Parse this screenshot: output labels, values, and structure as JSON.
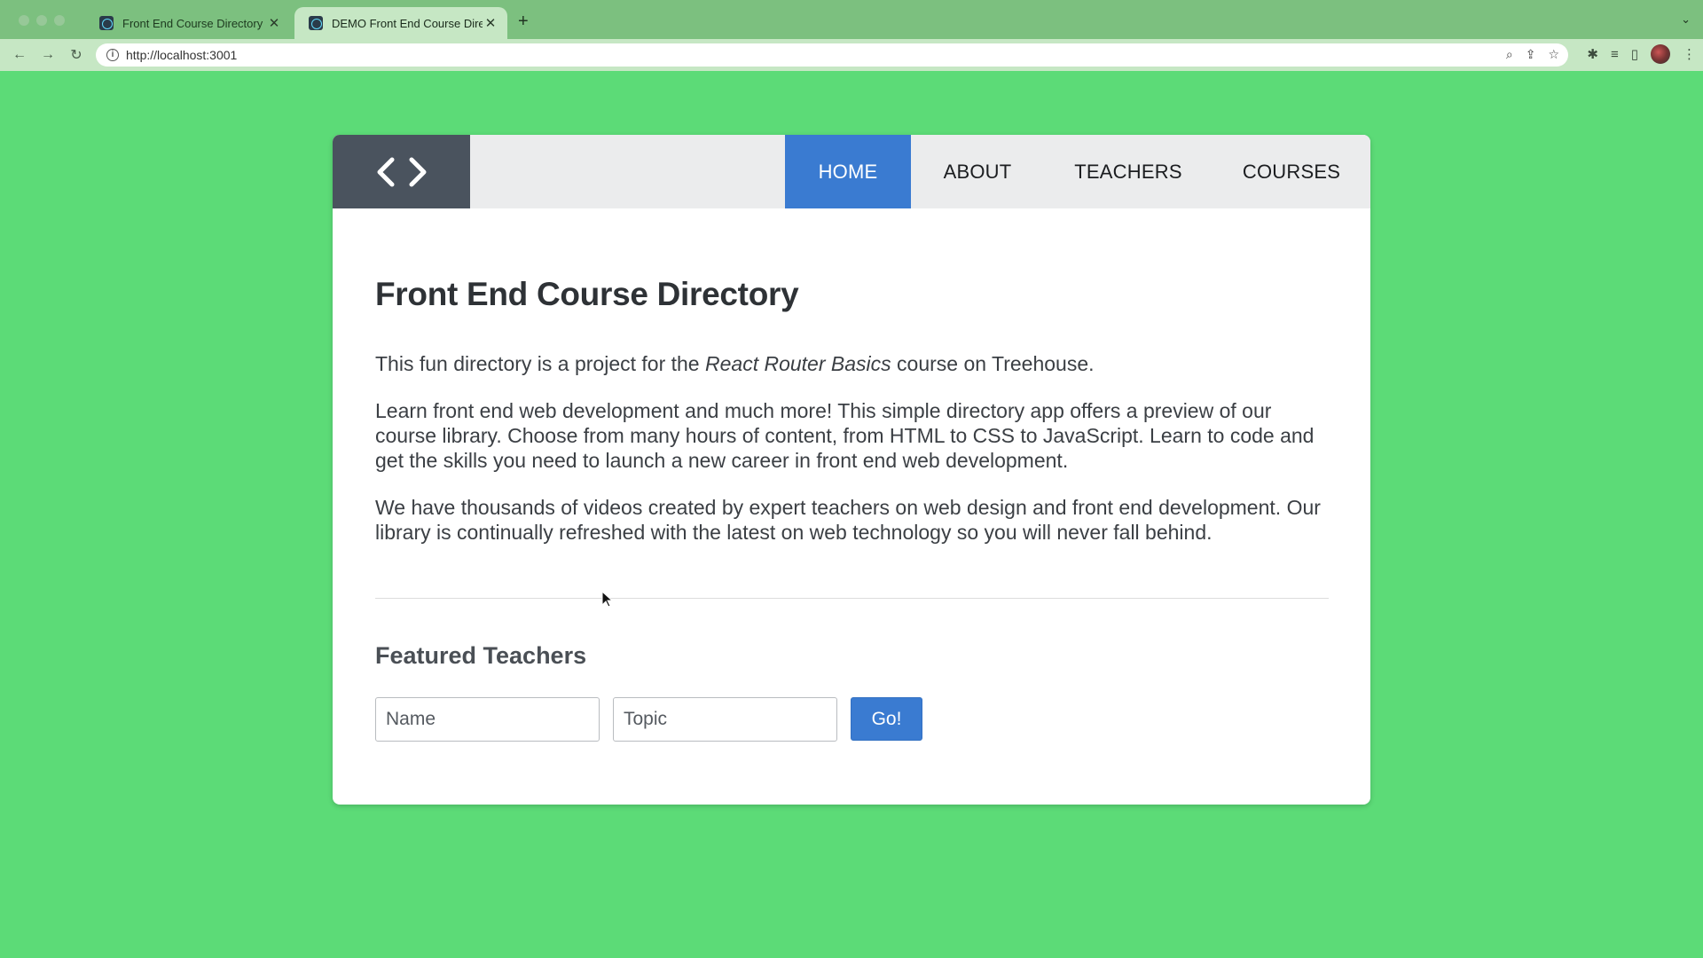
{
  "browser": {
    "tabs": [
      {
        "title": "Front End Course Directory",
        "active": false
      },
      {
        "title": "DEMO Front End Course Direct",
        "active": true
      }
    ],
    "new_tab_label": "+",
    "url": "http://localhost:3001"
  },
  "site": {
    "logo_icon": "code-brackets-icon",
    "nav": {
      "home": "HOME",
      "about": "ABOUT",
      "teachers": "TEACHERS",
      "courses": "COURSES"
    },
    "active_nav": "home",
    "accent_color": "#3a7bd1"
  },
  "page": {
    "title": "Front End Course Directory",
    "intro_before": "This fun directory is a project for the ",
    "intro_emphasis": "React Router Basics",
    "intro_after": " course on Treehouse.",
    "paragraph_2": "Learn front end web development and much more! This simple directory app offers a preview of our course library. Choose from many hours of content, from HTML to CSS to JavaScript. Learn to code and get the skills you need to launch a new career in front end web development.",
    "paragraph_3": "We have thousands of videos created by expert teachers on web design and front end development. Our library is continually refreshed with the latest on web technology so you will never fall behind."
  },
  "featured": {
    "title": "Featured Teachers",
    "name_placeholder": "Name",
    "topic_placeholder": "Topic",
    "submit_label": "Go!"
  }
}
